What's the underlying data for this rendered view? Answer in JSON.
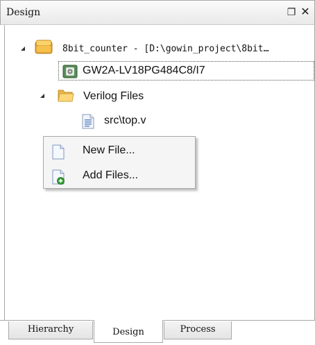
{
  "panel": {
    "title": "Design",
    "float_icon": "float-icon",
    "close_icon": "close-icon",
    "float_glyph": "❐",
    "close_glyph": "✕"
  },
  "tree": {
    "project": {
      "label": "8bit_counter - [D:\\gowin_project\\8bit…",
      "icon": "project-icon",
      "expanded": true
    },
    "device": {
      "label": "GW2A-LV18PG484C8/I7",
      "icon": "chip-icon"
    },
    "folder": {
      "label": "Verilog Files",
      "icon": "folder-icon",
      "expanded": true
    },
    "file": {
      "label": "src\\top.v",
      "icon": "verilog-file-icon"
    }
  },
  "context_menu": {
    "items": [
      {
        "label": "New File...",
        "icon": "new-file-icon"
      },
      {
        "label": "Add Files...",
        "icon": "add-files-icon"
      }
    ]
  },
  "tabs": [
    {
      "label": "Hierarchy",
      "active": false
    },
    {
      "label": "Design",
      "active": true
    },
    {
      "label": "Process",
      "active": false
    }
  ],
  "colors": {
    "title_bg": "#f0f0f0",
    "border": "#a8a8a8",
    "menu_bg": "#f5f5f5",
    "folder": "#f2c255",
    "add_badge": "#2e9e2e"
  }
}
